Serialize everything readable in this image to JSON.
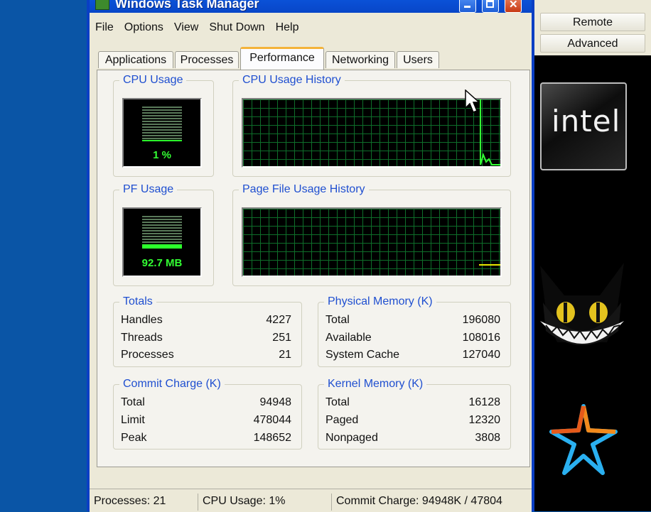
{
  "window": {
    "title": "Windows Task Manager"
  },
  "menu": [
    "File",
    "Options",
    "View",
    "Shut Down",
    "Help"
  ],
  "tabs": [
    {
      "label": "Applications",
      "active": false
    },
    {
      "label": "Processes",
      "active": false
    },
    {
      "label": "Performance",
      "active": true
    },
    {
      "label": "Networking",
      "active": false
    },
    {
      "label": "Users",
      "active": false
    }
  ],
  "performance": {
    "cpu_usage": {
      "label": "CPU Usage",
      "value_text": "1 %",
      "level_percent": 1
    },
    "cpu_history": {
      "label": "CPU Usage History"
    },
    "pf_usage": {
      "label": "PF Usage",
      "value_text": "92.7 MB",
      "level_percent": 7
    },
    "pf_history": {
      "label": "Page File Usage History"
    },
    "totals": {
      "label": "Totals",
      "rows": [
        {
          "label": "Handles",
          "value": "4227"
        },
        {
          "label": "Threads",
          "value": "251"
        },
        {
          "label": "Processes",
          "value": "21"
        }
      ]
    },
    "physical_memory": {
      "label": "Physical Memory (K)",
      "rows": [
        {
          "label": "Total",
          "value": "196080"
        },
        {
          "label": "Available",
          "value": "108016"
        },
        {
          "label": "System Cache",
          "value": "127040"
        }
      ]
    },
    "commit_charge": {
      "label": "Commit Charge (K)",
      "rows": [
        {
          "label": "Total",
          "value": "94948"
        },
        {
          "label": "Limit",
          "value": "478044"
        },
        {
          "label": "Peak",
          "value": "148652"
        }
      ]
    },
    "kernel_memory": {
      "label": "Kernel Memory (K)",
      "rows": [
        {
          "label": "Total",
          "value": "16128"
        },
        {
          "label": "Paged",
          "value": "12320"
        },
        {
          "label": "Nonpaged",
          "value": "3808"
        }
      ]
    }
  },
  "status_bar": {
    "processes": "Processes: 21",
    "cpu_usage": "CPU Usage: 1%",
    "commit_charge": "Commit Charge: 94948K / 47804"
  },
  "side_panel": {
    "remote_label": "Remote",
    "advanced_label": "Advanced",
    "logo_text": "intel"
  },
  "colors": {
    "desktop": "#0a55a6",
    "graph_line": "#33ff33",
    "graph_grid": "#0e6e2a",
    "group_label": "#1f4fd0",
    "active_tab_accent": "#f4b33a",
    "pf_history_line": "#e8e800"
  },
  "icons": [
    "app-icon",
    "minimize-icon",
    "maximize-icon",
    "close-icon",
    "mouse-cursor-icon",
    "cat-face-icon",
    "star-logo-icon"
  ]
}
